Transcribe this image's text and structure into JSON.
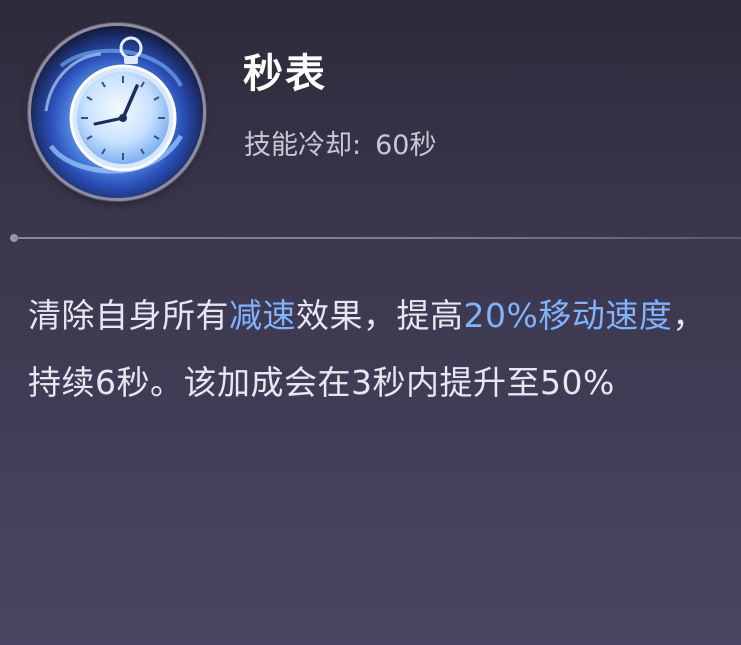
{
  "skill": {
    "name": "秒表",
    "cooldown_label": "技能冷却:",
    "cooldown_value": "60秒",
    "icon": "pocket-watch-icon"
  },
  "description": {
    "part1": "清除自身所有",
    "highlight1": "减速",
    "part2": "效果，提高",
    "highlight2": "20%移动速度",
    "part3": "，持续6秒。该加成会在3秒内提升至50%"
  },
  "colors": {
    "highlight": "#7fb2ff",
    "text": "#e9e6f2",
    "title": "#ffffff",
    "subtle": "#c9c6d6"
  }
}
